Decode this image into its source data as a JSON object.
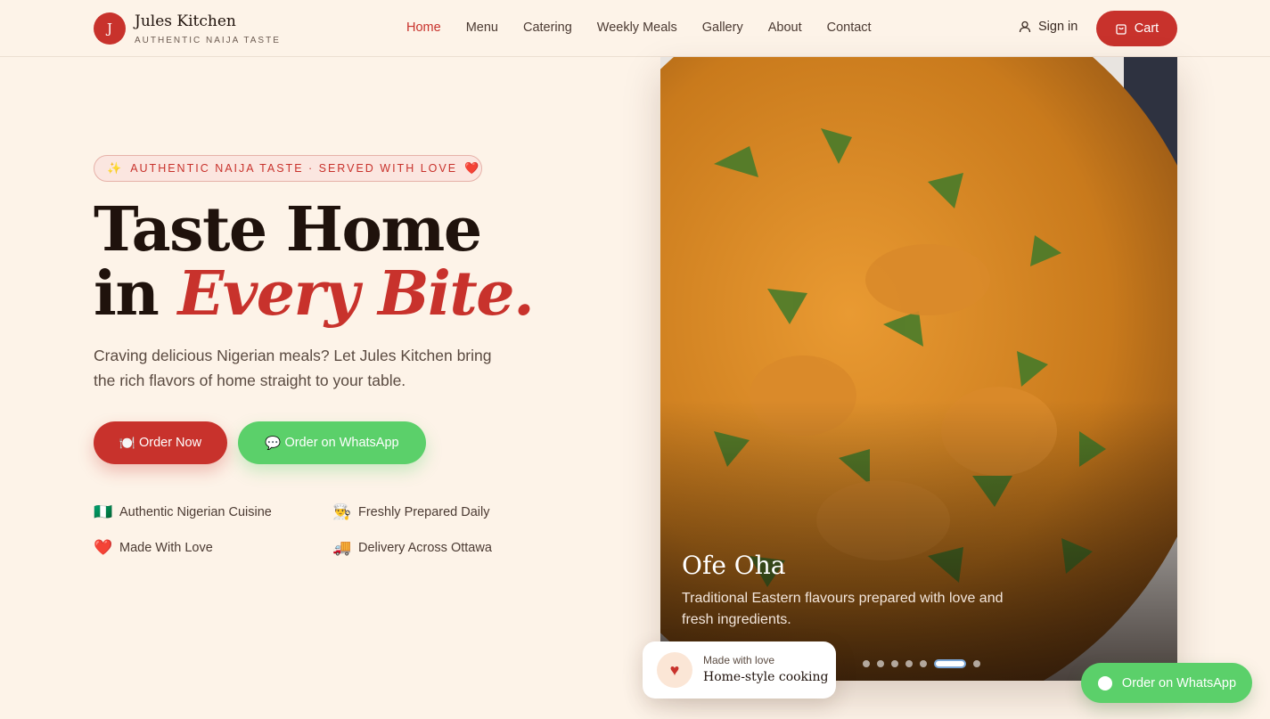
{
  "brand": {
    "initial": "J",
    "name": "Jules Kitchen",
    "tagline": "AUTHENTIC NAIJA TASTE"
  },
  "nav": {
    "items": [
      "Home",
      "Menu",
      "Catering",
      "Weekly Meals",
      "Gallery",
      "About",
      "Contact"
    ],
    "active": "Home",
    "signin_label": "Sign in",
    "cart_label": "Cart"
  },
  "hero": {
    "pill_text": "AUTHENTIC NAIJA TASTE · SERVED WITH LOVE",
    "headline_line1": "Taste Home",
    "headline_in": "in",
    "headline_accent": "Every Bite.",
    "subtext": "Craving delicious Nigerian meals? Let Jules Kitchen bring the rich flavors of home straight to your table.",
    "order_now_label": "Order Now",
    "order_whatsapp_label": "Order on WhatsApp",
    "features": [
      {
        "icon": "🇳🇬",
        "icon_name": "nigeria-flag-icon",
        "label": "Authentic Nigerian Cuisine"
      },
      {
        "icon": "👨‍🍳",
        "icon_name": "chef-icon",
        "label": "Freshly Prepared Daily"
      },
      {
        "icon": "❤️",
        "icon_name": "heart-icon",
        "label": "Made With Love"
      },
      {
        "icon": "🚚",
        "icon_name": "delivery-truck-icon",
        "label": "Delivery Across Ottawa"
      }
    ]
  },
  "slide": {
    "title": "Ofe Oha",
    "description": "Traditional Eastern flavours prepared with love and fresh ingredients.",
    "dot_count": 7,
    "active_dot": 5
  },
  "love_card": {
    "small": "Made with love",
    "big": "Home-style cooking"
  },
  "floating_whatsapp_label": "Order on WhatsApp",
  "colors": {
    "brand_red": "#c8322c",
    "whatsapp_green": "#5bd06a",
    "background": "#fdf3e8"
  }
}
